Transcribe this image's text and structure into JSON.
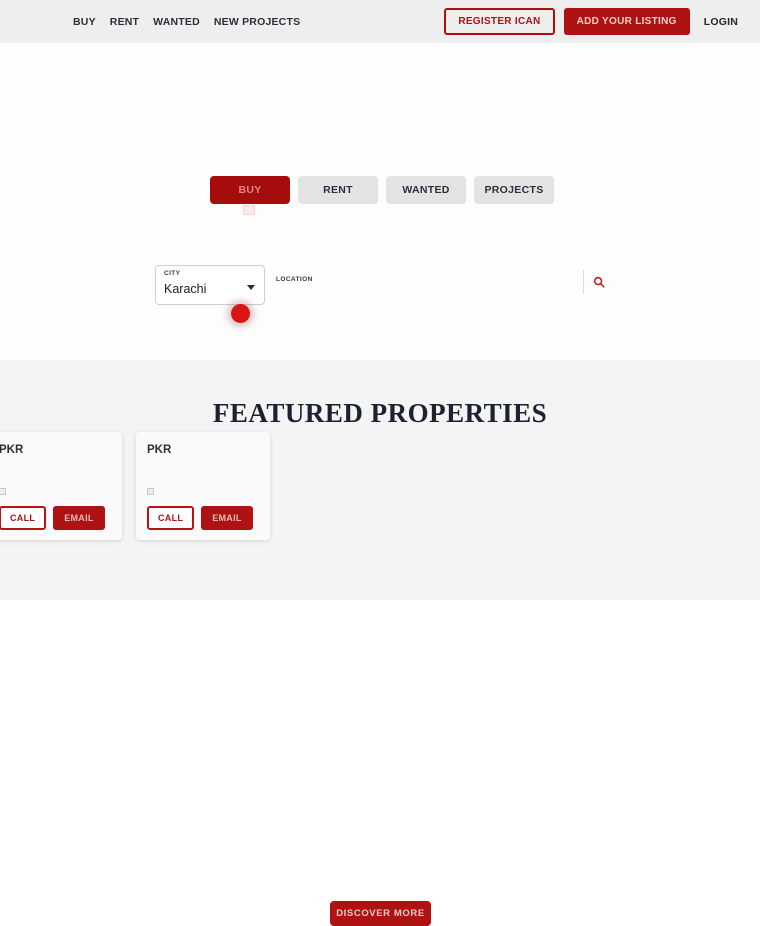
{
  "header": {
    "nav_items": [
      {
        "label": "BUY",
        "name": "nav-buy"
      },
      {
        "label": "RENT",
        "name": "nav-rent"
      },
      {
        "label": "WANTED",
        "name": "nav-wanted"
      },
      {
        "label": "NEW PROJECTS",
        "name": "nav-new-projects"
      }
    ],
    "register_label": "REGISTER ICAN",
    "add_listing_label": "ADD YOUR LISTING",
    "login_label": "LOGIN"
  },
  "hero": {
    "tabs": [
      {
        "label": "BUY",
        "active": true
      },
      {
        "label": "RENT",
        "active": false
      },
      {
        "label": "WANTED",
        "active": false
      },
      {
        "label": "PROJECTS",
        "active": false
      }
    ],
    "search": {
      "city_label": "CITY",
      "city_value": "Karachi",
      "location_label": "LOCATION",
      "search_icon": "search-icon"
    }
  },
  "featured": {
    "title": "FEATURED PROPERTIES",
    "cards": [
      {
        "price": "PKR",
        "call_label": "CALL",
        "email_label": "EMAIL"
      },
      {
        "price": "PKR",
        "call_label": "CALL",
        "email_label": "EMAIL"
      }
    ],
    "discover_label": "DISCOVER MORE"
  },
  "colors": {
    "brand_red": "#ae1212",
    "active_tab_red": "#a50d0d",
    "header_bg": "#eeeeee",
    "section_bg": "#f4f4f4",
    "title_color": "#1c2230",
    "cursor_red": "#d91414"
  }
}
